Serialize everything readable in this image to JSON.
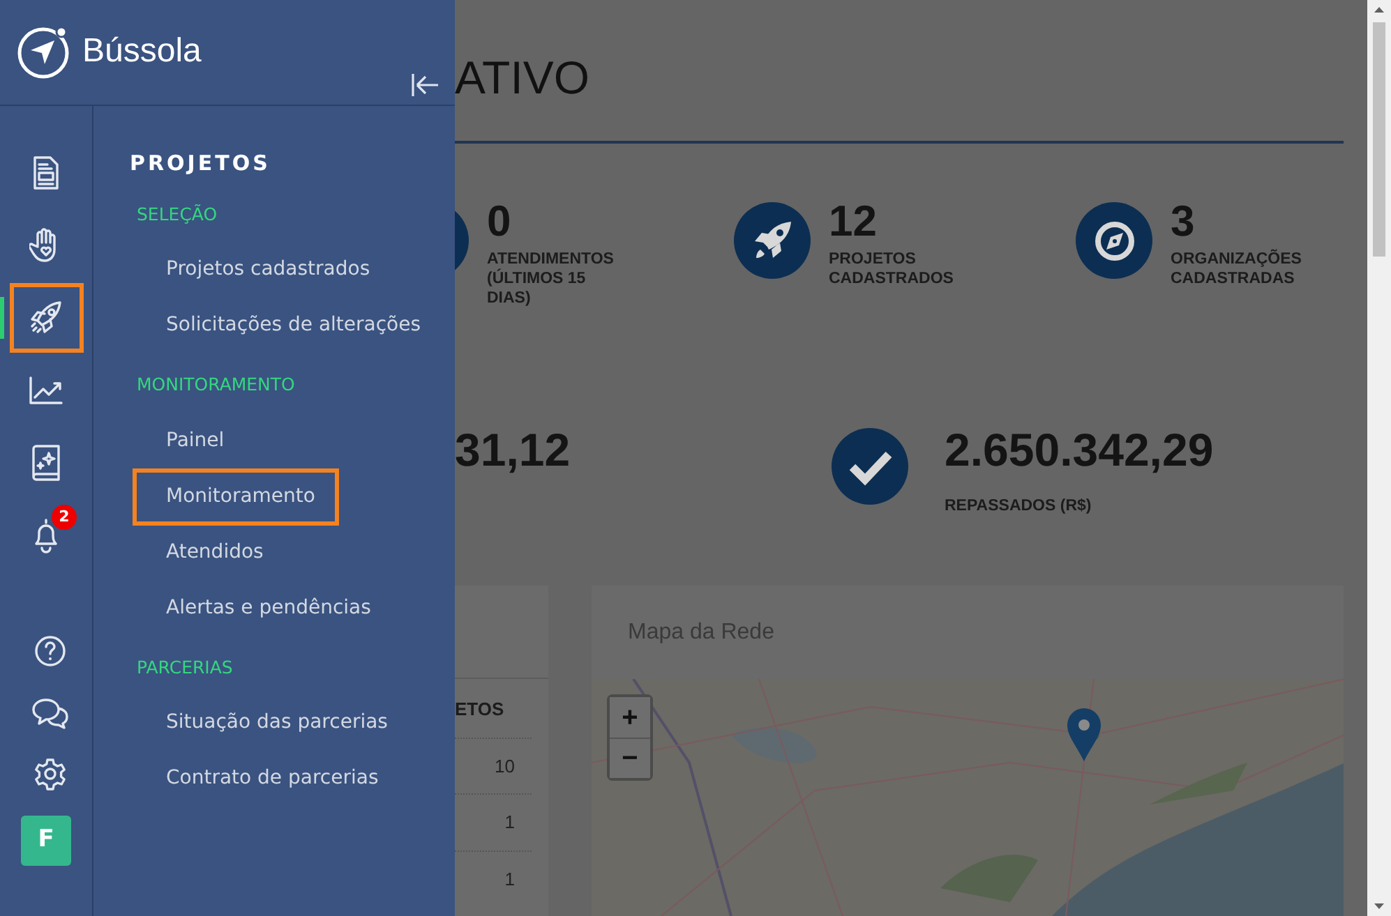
{
  "brand": {
    "name": "Bússola"
  },
  "rail": [
    {
      "kind": "document",
      "selected": false,
      "highlighted": false
    },
    {
      "kind": "hand",
      "selected": false,
      "highlighted": false
    },
    {
      "kind": "rocket",
      "selected": true,
      "highlighted": true
    },
    {
      "kind": "chart",
      "selected": false,
      "highlighted": false
    },
    {
      "kind": "book",
      "selected": false,
      "highlighted": false
    },
    {
      "kind": "bell",
      "selected": false,
      "highlighted": false,
      "badge": "2"
    }
  ],
  "rail_bottom": [
    {
      "kind": "help"
    },
    {
      "kind": "chat"
    },
    {
      "kind": "settings"
    },
    {
      "kind": "avatar",
      "text": "F"
    }
  ],
  "menu": {
    "title": "PROJETOS",
    "sections": [
      {
        "heading": "SELEÇÃO",
        "items": [
          {
            "label": "Projetos cadastrados",
            "highlighted": false
          },
          {
            "label": "Solicitações de alterações",
            "highlighted": false
          }
        ]
      },
      {
        "heading": "MONITORAMENTO",
        "items": [
          {
            "label": "Painel",
            "highlighted": false
          },
          {
            "label": "Monitoramento",
            "highlighted": true
          },
          {
            "label": "Atendidos",
            "highlighted": false
          },
          {
            "label": "Alertas e pendências",
            "highlighted": false
          }
        ]
      },
      {
        "heading": "PARCERIAS",
        "items": [
          {
            "label": "Situação das parcerias",
            "highlighted": false
          },
          {
            "label": "Contrato de parcerias",
            "highlighted": false
          }
        ]
      }
    ]
  },
  "page": {
    "title": "ATIVO",
    "stats": [
      {
        "kind": "hidden",
        "value": "0",
        "label": "ATENDIMENTOS (ÚLTIMOS 15 DIAS)"
      },
      {
        "kind": "rocket",
        "value": "12",
        "label": "PROJETOS CADASTRADOS"
      },
      {
        "kind": "compass",
        "value": "3",
        "label": "ORGANIZAÇÕES CADASTRADAS"
      }
    ],
    "totals": [
      {
        "kind": "none",
        "value": "31,12"
      },
      {
        "kind": "check",
        "value": "2.650.342,29",
        "label": "REPASSADOS (R$)"
      }
    ],
    "table": {
      "column_header": "ETOS",
      "rows": [
        "10",
        "1",
        "1"
      ]
    },
    "map": {
      "title": "Mapa da Rede",
      "zoom_in": "+",
      "zoom_out": "−"
    }
  }
}
